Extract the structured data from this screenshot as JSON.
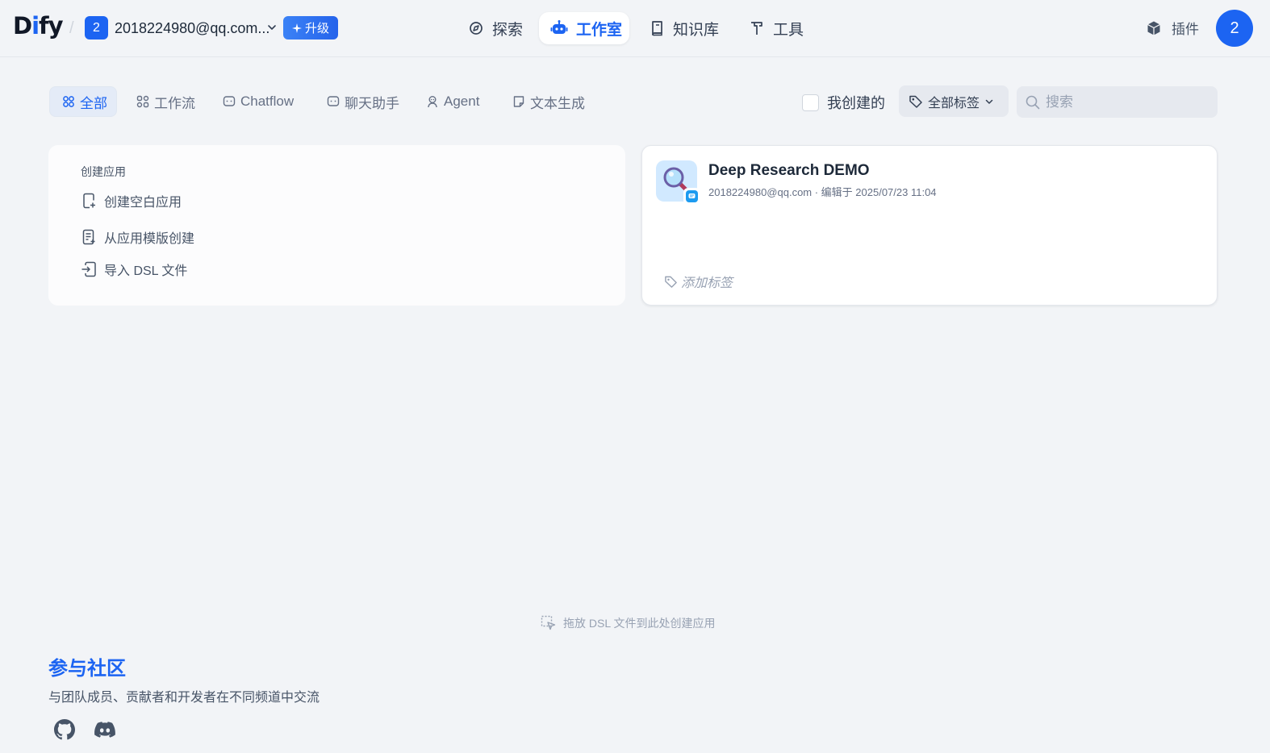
{
  "header": {
    "logo": "Dify",
    "workspace_badge": "2",
    "workspace_name": "2018224980@qq.com...",
    "upgrade_label": "升级",
    "nav": {
      "explore": "探索",
      "studio": "工作室",
      "knowledge": "知识库",
      "tools": "工具"
    },
    "plugins_label": "插件",
    "avatar_initial": "2"
  },
  "filters": {
    "tabs": {
      "all": "全部",
      "workflow": "工作流",
      "chatflow": "Chatflow",
      "chatbot": "聊天助手",
      "agent": "Agent",
      "completion": "文本生成"
    },
    "active_tab": "全部",
    "my_created_label": "我创建的",
    "tags_label": "全部标签",
    "search_placeholder": "搜索"
  },
  "create_card": {
    "title": "创建应用",
    "blank": "创建空白应用",
    "template": "从应用模版创建",
    "import_dsl": "导入 DSL 文件"
  },
  "apps": [
    {
      "name": "Deep Research DEMO",
      "meta": "2018224980@qq.com · 编辑于 2025/07/23 11:04",
      "add_tag": "添加标签"
    }
  ],
  "drop_hint": "拖放 DSL 文件到此处创建应用",
  "community": {
    "title": "参与社区",
    "description": "与团队成员、贡献者和开发者在不同频道中交流"
  },
  "colors": {
    "accent": "#1c64f2",
    "background": "#f2f4f7"
  },
  "icons": {
    "explore": "compass-icon",
    "studio": "robot-icon",
    "knowledge": "book-icon",
    "tools": "hammer-icon",
    "plugins": "cube-icon",
    "github": "github-icon",
    "discord": "discord-icon"
  }
}
